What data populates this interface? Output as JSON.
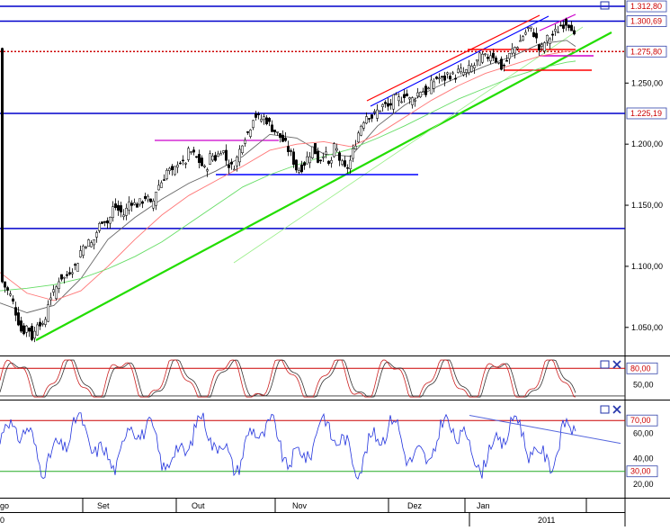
{
  "chart_data": [
    {
      "type": "candlestick",
      "panel": "price",
      "y_range": [
        1027,
        1318
      ],
      "tick_labels": [
        "1.050,00",
        "1.100,00",
        "1.150,00",
        "1.200,00",
        "1.250,00"
      ],
      "tick_values": [
        1050,
        1100,
        1150,
        1200,
        1250
      ],
      "level_labels": [
        {
          "text": "1.312,80",
          "value": 1312.8,
          "color": "#cc0000"
        },
        {
          "text": "1.300,69",
          "value": 1300.69,
          "color": "#cc0000"
        },
        {
          "text": "1.275,80",
          "value": 1275.8,
          "color": "#cc0000"
        },
        {
          "text": "1.225,19",
          "value": 1225.19,
          "color": "#cc0000"
        }
      ],
      "horizontal_lines": [
        {
          "value": 1312.8,
          "color": "#0000cc"
        },
        {
          "value": 1300.69,
          "color": "#0000cc"
        },
        {
          "value": 1275.8,
          "color": "#cc0000",
          "style": "dotted"
        },
        {
          "value": 1225.19,
          "color": "#0000cc"
        },
        {
          "value": 1131,
          "color": "#0000cc"
        }
      ],
      "series": [
        {
          "kind": "close",
          "points": [
            [
              0,
              1090
            ],
            [
              6,
              1082
            ],
            [
              12,
              1075
            ],
            [
              18,
              1060
            ],
            [
              24,
              1045
            ],
            [
              30,
              1052
            ],
            [
              36,
              1040
            ],
            [
              42,
              1058
            ],
            [
              48,
              1048
            ],
            [
              54,
              1075
            ],
            [
              60,
              1078
            ],
            [
              66,
              1092
            ],
            [
              72,
              1090
            ],
            [
              78,
              1098
            ],
            [
              84,
              1100
            ],
            [
              90,
              1115
            ],
            [
              96,
              1120
            ],
            [
              102,
              1118
            ],
            [
              108,
              1130
            ],
            [
              114,
              1140
            ],
            [
              120,
              1135
            ],
            [
              126,
              1150
            ],
            [
              132,
              1145
            ],
            [
              138,
              1142
            ],
            [
              144,
              1155
            ],
            [
              150,
              1150
            ],
            [
              156,
              1152
            ],
            [
              162,
              1158
            ],
            [
              168,
              1148
            ],
            [
              174,
              1165
            ],
            [
              180,
              1170
            ],
            [
              186,
              1180
            ],
            [
              192,
              1175
            ],
            [
              198,
              1188
            ],
            [
              204,
              1182
            ],
            [
              210,
              1195
            ],
            [
              216,
              1190
            ],
            [
              222,
              1185
            ],
            [
              228,
              1178
            ],
            [
              234,
              1192
            ],
            [
              240,
              1188
            ],
            [
              246,
              1198
            ],
            [
              252,
              1185
            ],
            [
              258,
              1180
            ],
            [
              264,
              1190
            ],
            [
              270,
              1205
            ],
            [
              276,
              1210
            ],
            [
              282,
              1225
            ],
            [
              288,
              1220
            ],
            [
              294,
              1222
            ],
            [
              300,
              1215
            ],
            [
              306,
              1210
            ],
            [
              312,
              1205
            ],
            [
              318,
              1198
            ],
            [
              324,
              1190
            ],
            [
              330,
              1178
            ],
            [
              336,
              1182
            ],
            [
              342,
              1190
            ],
            [
              348,
              1198
            ],
            [
              354,
              1185
            ],
            [
              360,
              1195
            ],
            [
              366,
              1180
            ],
            [
              372,
              1200
            ],
            [
              378,
              1185
            ],
            [
              384,
              1178
            ],
            [
              390,
              1188
            ],
            [
              396,
              1205
            ],
            [
              402,
              1218
            ],
            [
              408,
              1225
            ],
            [
              414,
              1222
            ],
            [
              420,
              1228
            ],
            [
              426,
              1232
            ],
            [
              432,
              1230
            ],
            [
              438,
              1238
            ],
            [
              444,
              1236
            ],
            [
              450,
              1242
            ],
            [
              456,
              1235
            ],
            [
              462,
              1240
            ],
            [
              468,
              1245
            ],
            [
              474,
              1242
            ],
            [
              480,
              1250
            ],
            [
              486,
              1255
            ],
            [
              492,
              1252
            ],
            [
              498,
              1258
            ],
            [
              504,
              1255
            ],
            [
              510,
              1260
            ],
            [
              516,
              1258
            ],
            [
              522,
              1262
            ],
            [
              528,
              1265
            ],
            [
              534,
              1272
            ],
            [
              540,
              1270
            ],
            [
              546,
              1275
            ],
            [
              552,
              1268
            ],
            [
              558,
              1262
            ],
            [
              564,
              1270
            ],
            [
              570,
              1278
            ],
            [
              576,
              1282
            ],
            [
              582,
              1290
            ],
            [
              588,
              1295
            ],
            [
              594,
              1290
            ],
            [
              600,
              1275
            ],
            [
              606,
              1285
            ],
            [
              612,
              1288
            ],
            [
              618,
              1292
            ],
            [
              624,
              1298
            ],
            [
              630,
              1300
            ],
            [
              636,
              1296
            ],
            [
              640,
              1278
            ]
          ]
        },
        {
          "kind": "ma-short",
          "color": "#666666",
          "points": [
            [
              0,
              1070
            ],
            [
              30,
              1062
            ],
            [
              60,
              1068
            ],
            [
              90,
              1090
            ],
            [
              120,
              1122
            ],
            [
              150,
              1140
            ],
            [
              180,
              1155
            ],
            [
              210,
              1168
            ],
            [
              240,
              1178
            ],
            [
              270,
              1190
            ],
            [
              300,
              1208
            ],
            [
              330,
              1205
            ],
            [
              360,
              1192
            ],
            [
              390,
              1190
            ],
            [
              420,
              1215
            ],
            [
              450,
              1232
            ],
            [
              480,
              1245
            ],
            [
              510,
              1255
            ],
            [
              540,
              1264
            ],
            [
              570,
              1272
            ],
            [
              600,
              1282
            ],
            [
              630,
              1285
            ],
            [
              640,
              1280
            ]
          ]
        },
        {
          "kind": "ma-mid",
          "color": "#ff7777",
          "points": [
            [
              0,
              1095
            ],
            [
              30,
              1078
            ],
            [
              60,
              1072
            ],
            [
              90,
              1080
            ],
            [
              120,
              1100
            ],
            [
              150,
              1122
            ],
            [
              180,
              1142
            ],
            [
              210,
              1158
            ],
            [
              240,
              1170
            ],
            [
              270,
              1182
            ],
            [
              300,
              1195
            ],
            [
              330,
              1200
            ],
            [
              360,
              1202
            ],
            [
              390,
              1198
            ],
            [
              420,
              1208
            ],
            [
              450,
              1222
            ],
            [
              480,
              1236
            ],
            [
              510,
              1248
            ],
            [
              540,
              1258
            ],
            [
              570,
              1265
            ],
            [
              600,
              1272
            ],
            [
              630,
              1276
            ],
            [
              640,
              1276
            ]
          ]
        },
        {
          "kind": "ma-long",
          "color": "#66dd66",
          "points": [
            [
              0,
              1080
            ],
            [
              30,
              1082
            ],
            [
              60,
              1085
            ],
            [
              90,
              1090
            ],
            [
              120,
              1098
            ],
            [
              150,
              1108
            ],
            [
              180,
              1120
            ],
            [
              210,
              1135
            ],
            [
              240,
              1150
            ],
            [
              270,
              1165
            ],
            [
              300,
              1175
            ],
            [
              330,
              1183
            ],
            [
              360,
              1190
            ],
            [
              390,
              1196
            ],
            [
              420,
              1205
            ],
            [
              450,
              1215
            ],
            [
              480,
              1226
            ],
            [
              510,
              1237
            ],
            [
              540,
              1246
            ],
            [
              570,
              1255
            ],
            [
              600,
              1262
            ],
            [
              630,
              1267
            ],
            [
              640,
              1268
            ]
          ]
        }
      ]
    },
    {
      "type": "line",
      "panel": "stochastic",
      "y_range": [
        25,
        100
      ],
      "tick_labels": [
        "50,00"
      ],
      "tick_values": [
        50
      ],
      "level_label": {
        "text": "80,00",
        "value": 80,
        "color": "#cc0000"
      }
    },
    {
      "type": "line",
      "panel": "rsi",
      "y_range": [
        10,
        85
      ],
      "tick_labels": [
        "60,00",
        "40,00",
        "20,00"
      ],
      "tick_values": [
        60,
        40,
        20
      ],
      "level_labels": [
        {
          "text": "70,00",
          "value": 70,
          "color": "#cc0000"
        },
        {
          "text": "30,00",
          "value": 30,
          "color": "#cc0000"
        }
      ]
    },
    {
      "type": "time-axis",
      "months": [
        "go",
        "Set",
        "Out",
        "Nov",
        "Dez",
        "Jan"
      ],
      "year_left": "0",
      "year_right": "2011"
    }
  ],
  "colors": {
    "axis": "#000000",
    "level_blue": "#0000cc",
    "level_red": "#cc0000",
    "trend_green": "#22dd00",
    "channel_red": "#ff0000",
    "channel_blue": "#0000ff",
    "magenta": "#cc00cc",
    "osc_red": "#cc2222",
    "osc_black": "#333333",
    "rsi_blue": "#2233dd",
    "rsi_trend": "#5566dd"
  },
  "icons": [
    "panel-maximize-icon",
    "panel-close-icon"
  ]
}
